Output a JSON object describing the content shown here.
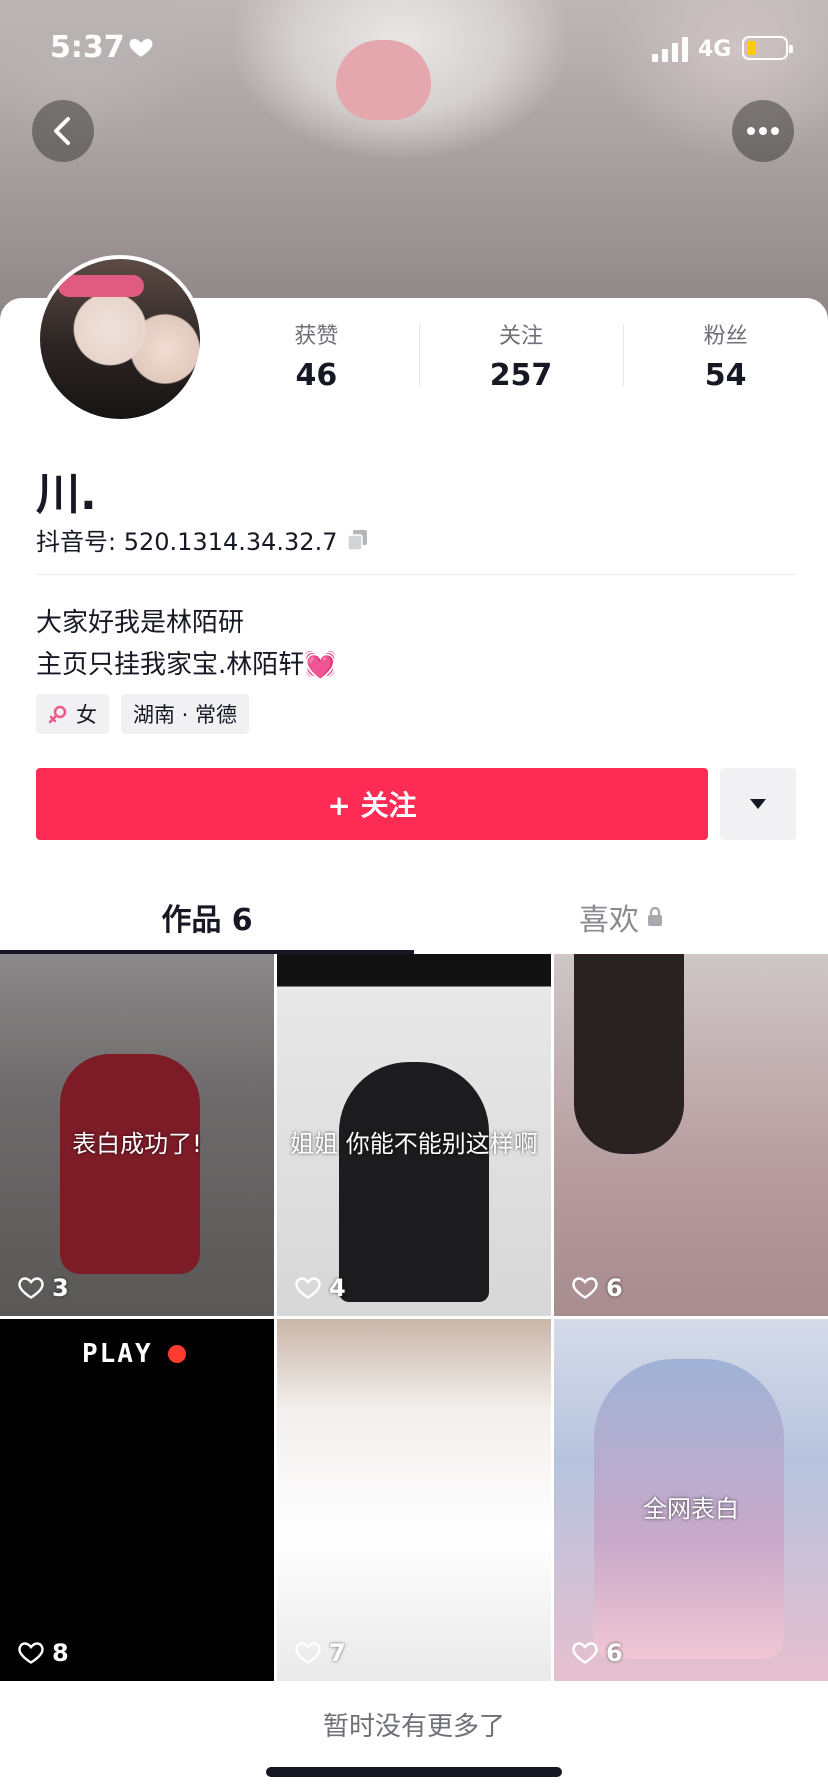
{
  "status_bar": {
    "time": "5:37",
    "network": "4G"
  },
  "stats": [
    {
      "label": "获赞",
      "value": "46"
    },
    {
      "label": "关注",
      "value": "257"
    },
    {
      "label": "粉丝",
      "value": "54"
    }
  ],
  "profile": {
    "nickname": "川.",
    "douyin_id": "抖音号: 520.1314.34.32.7",
    "bio_line1": "大家好我是林陌研",
    "bio_line2": "主页只挂我家宝.林陌轩💓",
    "tags": [
      "女",
      "湖南 · 常德"
    ]
  },
  "follow_button": "+ 关注",
  "tabs": [
    {
      "label": "作品 6",
      "active": true
    },
    {
      "label": "喜欢",
      "active": false
    }
  ],
  "videos": [
    {
      "caption": "表白成功了!",
      "likes": "3"
    },
    {
      "caption": "姐姐 你能不能别这样啊",
      "likes": "4"
    },
    {
      "caption": "",
      "likes": "6"
    },
    {
      "caption": "PLAY",
      "likes": "8"
    },
    {
      "caption": "",
      "likes": "7"
    },
    {
      "caption": "全网表白",
      "likes": "6"
    }
  ],
  "footer": "暂时没有更多了",
  "colors": {
    "accent": "#fe2c55",
    "text": "#161823",
    "muted": "#6f7077"
  }
}
